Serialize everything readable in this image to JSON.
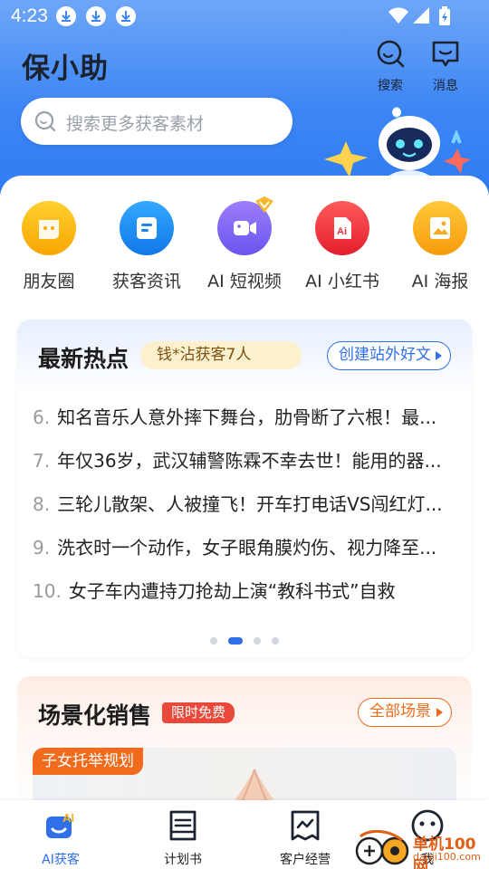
{
  "status_bar": {
    "time": "4:23",
    "download_icons": [
      "download-icon",
      "download-icon",
      "download-icon"
    ],
    "battery": "battery-charging-icon"
  },
  "header": {
    "title": "保小助",
    "search_label": "搜索",
    "messages_label": "消息"
  },
  "search": {
    "placeholder": "搜索更多获客素材"
  },
  "features": [
    {
      "label": "朋友圈",
      "icon": "moments-icon",
      "color": "#fbb614"
    },
    {
      "label": "获客资讯",
      "icon": "news-icon",
      "color": "#1c8ff0"
    },
    {
      "label": "AI 短视频",
      "icon": "video-icon",
      "color": "#7b6cf3"
    },
    {
      "label": "AI 小红书",
      "icon": "xiaohongshu-icon",
      "color": "#ee2f3a"
    },
    {
      "label": "AI 海报",
      "icon": "poster-icon",
      "color": "#fbab13"
    }
  ],
  "hot": {
    "title": "最新热点",
    "tag": "钱*沾获客7人",
    "button": "创建站外好文",
    "items": [
      {
        "num": "6.",
        "text": "知名音乐人意外摔下舞台，肋骨断了六根！最..."
      },
      {
        "num": "7.",
        "text": "年仅36岁，武汉辅警陈霖不幸去世！能用的器..."
      },
      {
        "num": "8.",
        "text": "三轮儿散架、人被撞飞！开车打电话VS闯红灯..."
      },
      {
        "num": "9.",
        "text": "洗衣时一个动作，女子眼角膜灼伤、视力降至..."
      },
      {
        "num": "10.",
        "text": "女子车内遭持刀抢劫上演“教科书式”自救"
      }
    ],
    "pager": {
      "count": 4,
      "active": 2
    }
  },
  "scene": {
    "title": "场景化销售",
    "tag": "限时免费",
    "button": "全部场景",
    "card_label": "子女托举规划"
  },
  "tabbar": [
    {
      "label": "AI获客",
      "icon": "ai-acquire-icon",
      "active": true
    },
    {
      "label": "计划书",
      "icon": "plan-book-icon",
      "active": false
    },
    {
      "label": "客户经营",
      "icon": "customer-manage-icon",
      "active": false
    },
    {
      "label": "我",
      "icon": "me-icon",
      "active": false
    }
  ],
  "watermark": {
    "line1": "单机100网",
    "line2": "danji100.com"
  },
  "colors": {
    "brand_blue": "#2f6fe8",
    "header_blue": "#3d86f4",
    "orange": "#f06a1a",
    "red_tag": "#e8493a"
  }
}
